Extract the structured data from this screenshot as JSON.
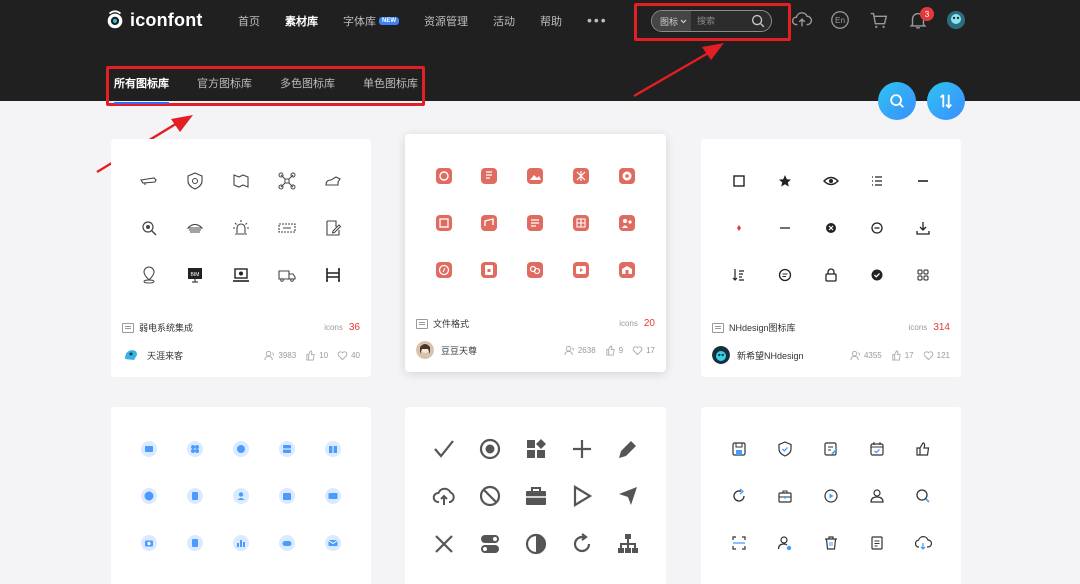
{
  "header": {
    "logo_text": "iconfont",
    "nav": [
      {
        "label": "首页",
        "active": false
      },
      {
        "label": "素材库",
        "active": true
      },
      {
        "label": "字体库",
        "active": false,
        "badge": "NEW"
      },
      {
        "label": "资源管理",
        "active": false
      },
      {
        "label": "活动",
        "active": false
      },
      {
        "label": "帮助",
        "active": false
      }
    ],
    "more": "•••",
    "search": {
      "type": "图标",
      "placeholder": "搜索"
    },
    "notifications": "3",
    "lang": "En",
    "icons": [
      "upload-icon",
      "lang-icon",
      "cart-icon",
      "bell-icon",
      "avatar"
    ]
  },
  "tabs": [
    {
      "label": "所有图标库",
      "active": true
    },
    {
      "label": "官方图标库",
      "active": false
    },
    {
      "label": "多色图标库",
      "active": false
    },
    {
      "label": "单色图标库",
      "active": false
    }
  ],
  "colors": {
    "accent": "#2f6bff",
    "highlight": "#e31e24",
    "count": "#e4393c",
    "coral": "#e06b60",
    "blue": "#4a9bff"
  },
  "cards": [
    {
      "name": "弱电系统集成",
      "icons_label": "icons",
      "count": "36",
      "author": "天涯来客",
      "views": "3983",
      "likes": "10",
      "favs": "40",
      "style": "line-dark",
      "avatar": "#38b2e8"
    },
    {
      "name": "文件格式",
      "icons_label": "icons",
      "count": "20",
      "author": "豆豆天尊",
      "views": "2638",
      "likes": "9",
      "favs": "17",
      "style": "coral",
      "avatar": "#c9a98c"
    },
    {
      "name": "NHdesign图标库",
      "icons_label": "icons",
      "count": "314",
      "author": "新希望NHdesign",
      "views": "4355",
      "likes": "17",
      "favs": "121",
      "style": "mono",
      "avatar": "#1f8fb5"
    }
  ],
  "cards_bottom": [
    {
      "style": "blue"
    },
    {
      "style": "gray-big"
    },
    {
      "style": "line-blue"
    }
  ]
}
